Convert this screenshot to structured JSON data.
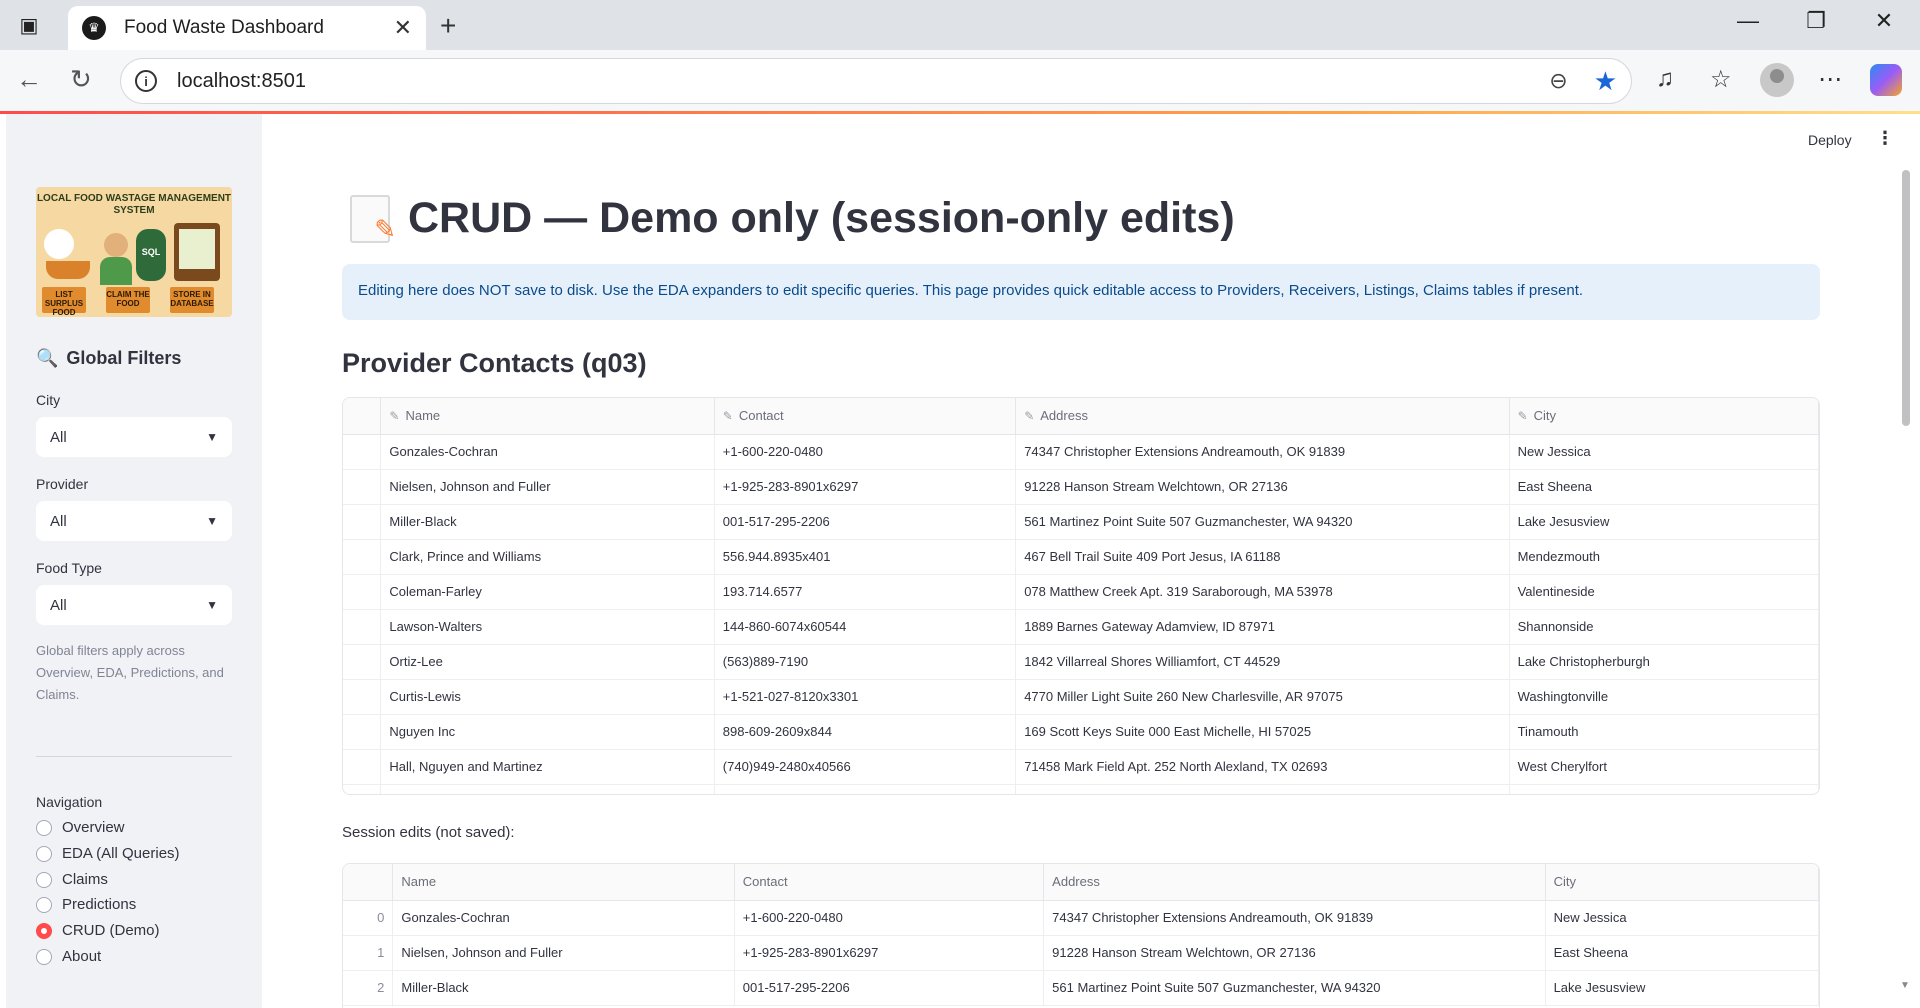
{
  "browser": {
    "tab_title": "Food Waste Dashboard",
    "url": "localhost:8501"
  },
  "app": {
    "deploy_label": "Deploy"
  },
  "sidebar": {
    "logo_text": "LOCAL FOOD WASTAGE MANAGEMENT SYSTEM",
    "logo_labels": [
      "LIST SURPLUS FOOD",
      "CLAIM THE FOOD",
      "STORE IN DATABASE"
    ],
    "logo_db": "SQL",
    "heading": "Global Filters",
    "filters": [
      {
        "label": "City",
        "value": "All"
      },
      {
        "label": "Provider",
        "value": "All"
      },
      {
        "label": "Food Type",
        "value": "All"
      }
    ],
    "caption": "Global filters apply across Overview, EDA, Predictions, and Claims.",
    "nav_label": "Navigation",
    "nav_items": [
      "Overview",
      "EDA (All Queries)",
      "Claims",
      "Predictions",
      "CRUD (Demo)",
      "About"
    ],
    "nav_selected": "CRUD (Demo)"
  },
  "main": {
    "title": "CRUD — Demo only (session-only edits)",
    "info": "Editing here does NOT save to disk. Use the EDA expanders to edit specific queries. This page provides quick editable access to Providers, Receivers, Listings, Claims tables if present.",
    "section_title": "Provider Contacts (q03)",
    "columns": [
      "Name",
      "Contact",
      "Address",
      "City"
    ],
    "rows": [
      [
        "Gonzales-Cochran",
        "+1-600-220-0480",
        "74347 Christopher Extensions Andreamouth, OK 91839",
        "New Jessica"
      ],
      [
        "Nielsen, Johnson and Fuller",
        "+1-925-283-8901x6297",
        "91228 Hanson Stream Welchtown, OR 27136",
        "East Sheena"
      ],
      [
        "Miller-Black",
        "001-517-295-2206",
        "561 Martinez Point Suite 507 Guzmanchester, WA 94320",
        "Lake Jesusview"
      ],
      [
        "Clark, Prince and Williams",
        "556.944.8935x401",
        "467 Bell Trail Suite 409 Port Jesus, IA 61188",
        "Mendezmouth"
      ],
      [
        "Coleman-Farley",
        "193.714.6577",
        "078 Matthew Creek Apt. 319 Saraborough, MA 53978",
        "Valentineside"
      ],
      [
        "Lawson-Walters",
        "144-860-6074x60544",
        "1889 Barnes Gateway Adamview, ID 87971",
        "Shannonside"
      ],
      [
        "Ortiz-Lee",
        "(563)889-7190",
        "1842 Villarreal Shores Williamfort, CT 44529",
        "Lake Christopherburgh"
      ],
      [
        "Curtis-Lewis",
        "+1-521-027-8120x3301",
        "4770 Miller Light Suite 260 New Charlesville, AR 97075",
        "Washingtonville"
      ],
      [
        "Nguyen Inc",
        "898-609-2609x844",
        "169 Scott Keys Suite 000 East Michelle, HI 57025",
        "Tinamouth"
      ],
      [
        "Hall, Nguyen and Martinez",
        "(740)949-2480x40566",
        "71458 Mark Field Apt. 252 North Alexland, TX 02693",
        "West Cherylfort"
      ]
    ],
    "session_caption": "Session edits (not saved):",
    "session_rows": [
      [
        "0",
        "Gonzales-Cochran",
        "+1-600-220-0480",
        "74347 Christopher Extensions Andreamouth, OK 91839",
        "New Jessica"
      ],
      [
        "1",
        "Nielsen, Johnson and Fuller",
        "+1-925-283-8901x6297",
        "91228 Hanson Stream Welchtown, OR 27136",
        "East Sheena"
      ],
      [
        "2",
        "Miller-Black",
        "001-517-295-2206",
        "561 Martinez Point Suite 507 Guzmanchester, WA 94320",
        "Lake Jesusview"
      ]
    ]
  },
  "icons": {
    "favicon": "crown-icon",
    "title_emoji": "memo-icon",
    "filters_emoji": "magnifier-icon",
    "edit_column": "edit-column-icon"
  },
  "colors": {
    "accent": "#ff4b4b",
    "info_bg": "#e6f0fb",
    "info_text": "#0a4b8c",
    "sidebar_bg": "#f0f2f6",
    "star": "#1a66d6"
  }
}
